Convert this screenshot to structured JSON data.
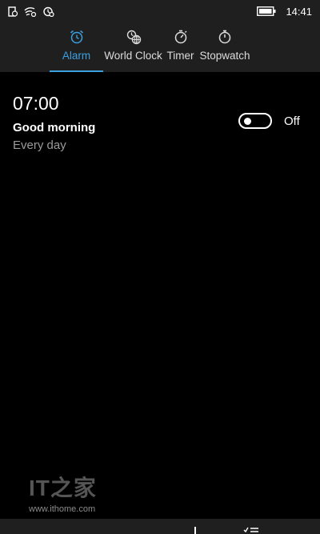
{
  "status_bar": {
    "time": "14:41",
    "icons": [
      "message-icon",
      "wifi-icon",
      "alarm-status-icon",
      "battery-icon"
    ]
  },
  "tabs": [
    {
      "label": "Alarm",
      "icon": "alarm-clock-icon",
      "active": true
    },
    {
      "label": "World Clock",
      "icon": "world-clock-icon",
      "active": false
    },
    {
      "label": "Timer",
      "icon": "timer-icon",
      "active": false
    },
    {
      "label": "Stopwatch",
      "icon": "stopwatch-icon",
      "active": false
    }
  ],
  "alarm": {
    "time": "07:00",
    "name": "Good morning",
    "repeat": "Every day",
    "toggle_state": "Off"
  },
  "watermark": {
    "logo": "IT之家",
    "url": "www.ithome.com"
  },
  "colors": {
    "accent": "#3aa0e0",
    "header_bg": "#1f1f1f",
    "background": "#000000",
    "secondary_text": "#9b9b9b"
  }
}
